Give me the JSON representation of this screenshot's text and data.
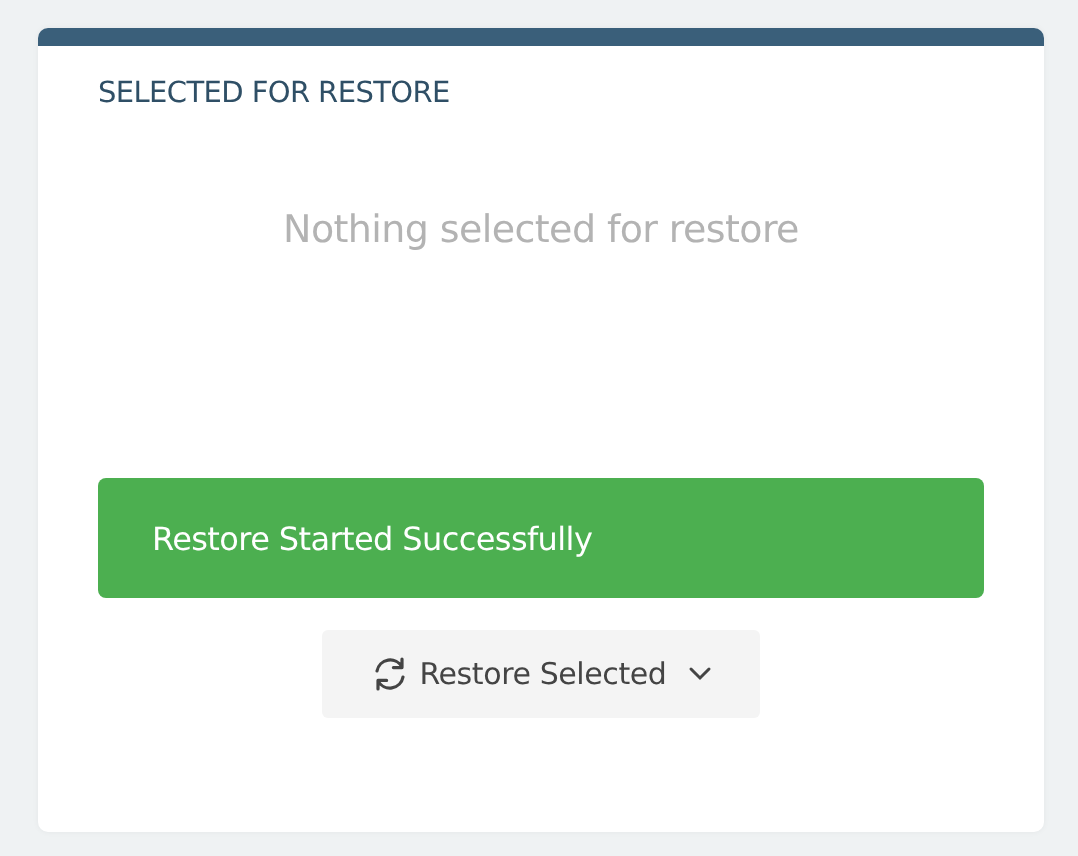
{
  "panel": {
    "title": "SELECTED FOR RESTORE",
    "empty_message": "Nothing selected for restore",
    "alert": {
      "kind": "success",
      "text": "Restore Started Successfully"
    },
    "restore_button": {
      "label": "Restore Selected"
    }
  }
}
